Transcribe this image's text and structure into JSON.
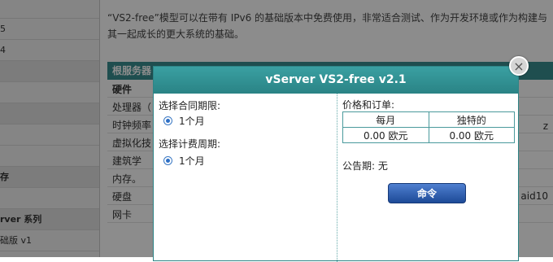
{
  "background": {
    "sidebar_items": [
      "5",
      "4",
      "",
      "",
      "",
      "",
      "",
      "存",
      "",
      "rver 系列",
      "础版 v1"
    ],
    "description": "“VS2-free”模型可以在带有 IPv6 的基础版本中免费使用，非常适合测试、作为开发环境或作为构建与其一起成长的更大系统的基础。",
    "table_header": "根服务器",
    "table_rows": [
      "硬件",
      "处理器（",
      "时钟频率",
      "虚拟化技",
      "建筑学",
      "内存。",
      "硬盘",
      "网卡"
    ],
    "right_texts": [
      "z",
      "aid10"
    ]
  },
  "dialog": {
    "title": "vServer VS2-free v2.1",
    "close_symbol": "×",
    "contract_label": "选择合同期限:",
    "contract_option": "1个月",
    "billing_label": "选择计费周期:",
    "billing_option": "1个月",
    "price_label": "价格和订单:",
    "price_headers": [
      "每月",
      "独特的"
    ],
    "price_values": [
      "0.00 欧元",
      "0.00 欧元"
    ],
    "notice": "公告期: 无",
    "order_button": "命令"
  }
}
